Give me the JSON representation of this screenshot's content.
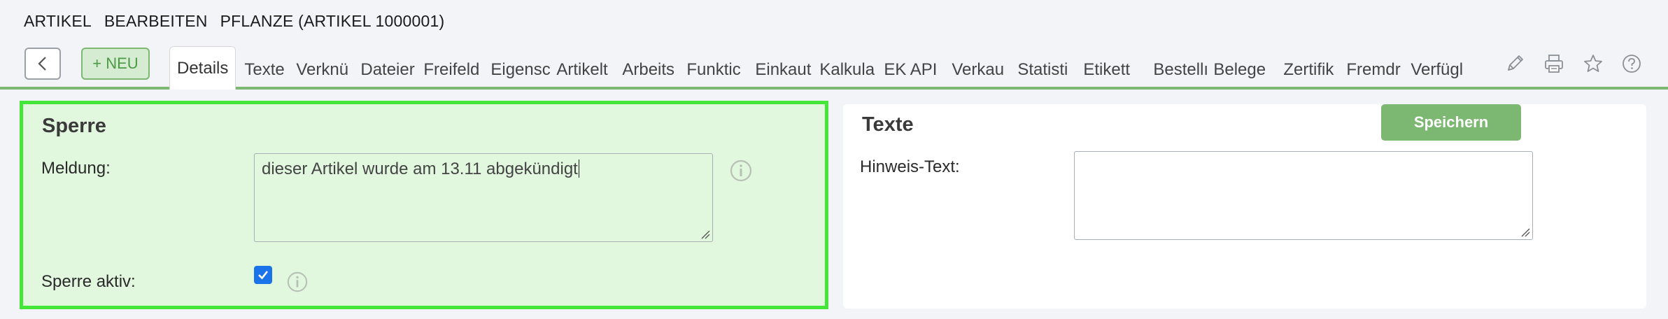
{
  "breadcrumb": {
    "part1": "ARTIKEL",
    "part2": "BEARBEITEN",
    "part3": "PFLANZE (ARTIKEL 1000001)"
  },
  "toolbar": {
    "new_label": "+ NEU",
    "tabs": [
      {
        "label": "Details",
        "active": true
      },
      {
        "label": "Texte"
      },
      {
        "label": "Verknü"
      },
      {
        "label": "Dateier"
      },
      {
        "label": "Freifeld"
      },
      {
        "label": "Eigensc"
      },
      {
        "label": "Artikelt"
      },
      {
        "label": "Arbeits"
      },
      {
        "label": "Funktic"
      },
      {
        "label": "Einkaut"
      },
      {
        "label": "Kalkula"
      },
      {
        "label": "EK API"
      },
      {
        "label": "Verkau"
      },
      {
        "label": "Statisti"
      },
      {
        "label": "Etikett"
      },
      {
        "label": "Bestellı"
      },
      {
        "label": "Belege"
      },
      {
        "label": "Zertifik"
      },
      {
        "label": "Fremdr"
      },
      {
        "label": "Verfügl"
      }
    ],
    "icons": [
      "pencil-icon",
      "printer-icon",
      "star-icon",
      "help-icon"
    ]
  },
  "sperre": {
    "title": "Sperre",
    "meldung_label": "Meldung:",
    "meldung_value": "dieser Artikel wurde am 13.11 abgekündigt",
    "aktiv_label": "Sperre aktiv:",
    "aktiv_checked": true
  },
  "texte": {
    "title": "Texte",
    "hinweis_label": "Hinweis-Text:",
    "hinweis_value": ""
  },
  "save_label": "Speichern",
  "colors": {
    "accent_green": "#7cb872",
    "highlight_border": "#44e63a",
    "highlight_bg": "#e1f8df",
    "checkbox_blue": "#1a73e8"
  }
}
